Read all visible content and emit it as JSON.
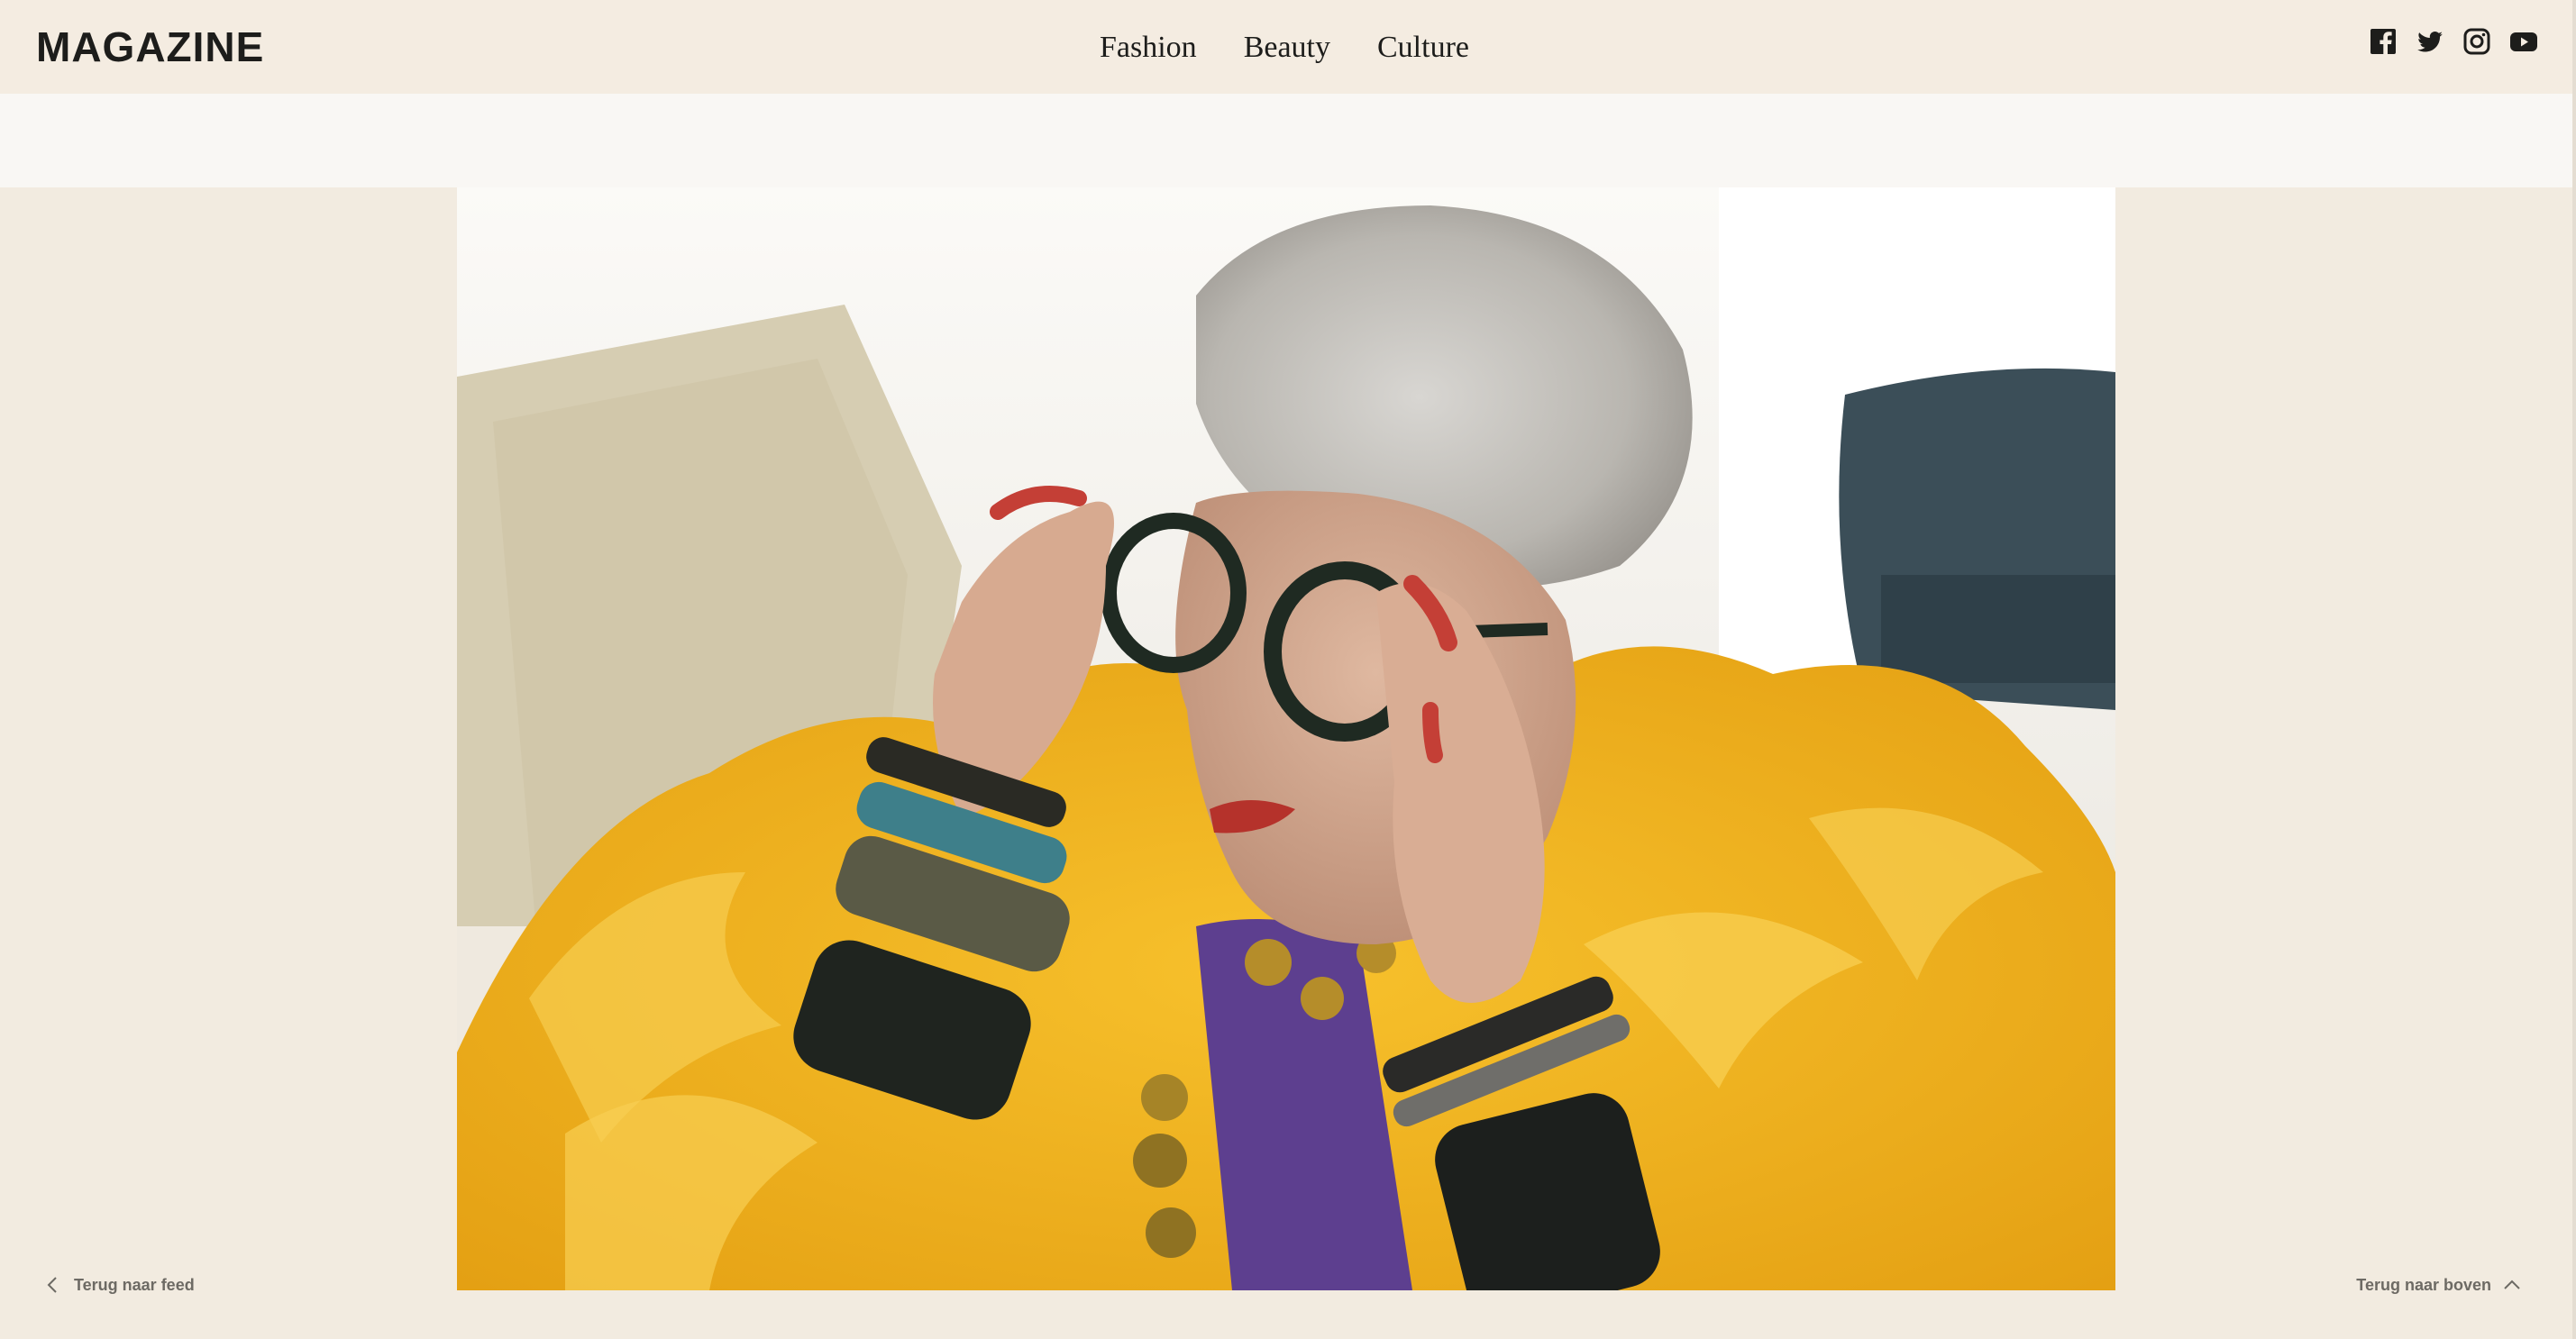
{
  "header": {
    "logo": "MAGAZINE",
    "nav": [
      {
        "label": "Fashion"
      },
      {
        "label": "Beauty"
      },
      {
        "label": "Culture"
      }
    ],
    "socials": [
      "facebook-icon",
      "twitter-icon",
      "instagram-icon",
      "youtube-icon"
    ]
  },
  "hero": {
    "description_icon": "photo"
  },
  "footer": {
    "back_to_feed": "Terug naar feed",
    "back_to_top": "Terug naar boven"
  },
  "colors": {
    "page_bg": "#f2ebe0",
    "banner_bg": "#f9f7f4",
    "text": "#1d1d1b",
    "muted": "#6d6a64",
    "yellow": "#f0b21a"
  }
}
